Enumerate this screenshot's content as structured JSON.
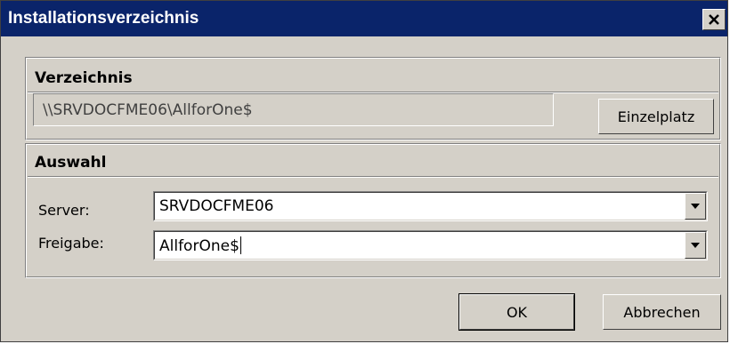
{
  "window": {
    "title": "Installationsverzeichnis",
    "close_icon": "close-icon"
  },
  "verzeichnis": {
    "header": "Verzeichnis",
    "path": "\\\\SRVDOCFME06\\AllforOne$",
    "einzelplatz_label": "Einzelplatz"
  },
  "auswahl": {
    "header": "Auswahl",
    "server_label": "Server:",
    "server_value": "SRVDOCFME06",
    "freigabe_label": "Freigabe:",
    "freigabe_value": "AllforOne$"
  },
  "buttons": {
    "ok_label": "OK",
    "cancel_label": "Abbrechen"
  },
  "colors": {
    "titlebar": "#0a246a",
    "face": "#d4d0c8"
  }
}
